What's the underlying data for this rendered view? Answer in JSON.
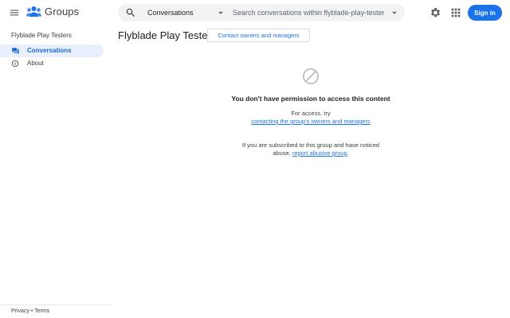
{
  "header": {
    "app_name": "Groups",
    "search": {
      "scope_label": "Conversations",
      "placeholder": "Search conversations within flyblade-play-testers..."
    },
    "signin_label": "Sign in"
  },
  "sidebar": {
    "group_name": "Flyblade Play Testers",
    "items": [
      {
        "label": "Conversations",
        "icon": "conversations-icon",
        "active": true
      },
      {
        "label": "About",
        "icon": "info-icon",
        "active": false
      }
    ],
    "footer": {
      "privacy": "Privacy",
      "separator": " • ",
      "terms": "Terms"
    }
  },
  "main": {
    "title": "Flyblade Play Testers",
    "contact_button": "Contact owners and managers",
    "no_permission_heading": "You don't have permission to access this content",
    "access_prefix": "For access, try",
    "access_link": "contacting the group's owners and managers",
    "abuse_prefix": "If you are subscribed to this group and have noticed abuse, ",
    "abuse_link": "report abusive group",
    "abuse_suffix": "."
  },
  "colors": {
    "primary": "#1a73e8",
    "active_bg": "#e8f0fe",
    "active_text": "#1967d2",
    "search_bg": "#f1f3f4"
  }
}
